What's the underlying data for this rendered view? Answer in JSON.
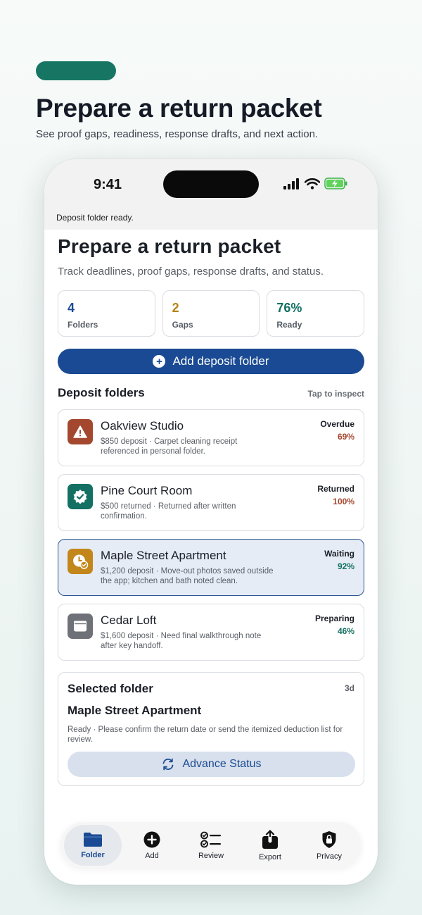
{
  "hero": {
    "title": "Prepare a return packet",
    "subtitle": "See proof gaps, readiness, response drafts, and next action."
  },
  "status_bar": {
    "time": "9:41"
  },
  "toast": "Deposit folder ready.",
  "page": {
    "title": "Prepare a return packet",
    "subtitle": "Track deadlines, proof gaps, response drafts, and status."
  },
  "stats": [
    {
      "value": "4",
      "label": "Folders",
      "color": "#1a4a93"
    },
    {
      "value": "2",
      "label": "Gaps",
      "color": "#b58413"
    },
    {
      "value": "76%",
      "label": "Ready",
      "color": "#137062"
    }
  ],
  "add_button_label": "Add deposit folder",
  "section": {
    "title": "Deposit folders",
    "hint": "Tap to inspect"
  },
  "folders": [
    {
      "name": "Oakview Studio",
      "desc": "$850 deposit · Carpet cleaning receipt referenced in personal folder.",
      "status": "Overdue",
      "pct": "69%",
      "pct_color": "#a3482f",
      "icon": "warning-icon",
      "icon_bg": "#a3482f"
    },
    {
      "name": "Pine Court Room",
      "desc": "$500 returned · Returned after written confirmation.",
      "status": "Returned",
      "pct": "100%",
      "pct_color": "#a3482f",
      "icon": "verified-badge-icon",
      "icon_bg": "#137062"
    },
    {
      "name": "Maple Street Apartment",
      "desc": "$1,200 deposit · Move-out photos saved outside the app; kitchen and bath noted clean.",
      "status": "Waiting",
      "pct": "92%",
      "pct_color": "#137062",
      "icon": "clock-check-icon",
      "icon_bg": "#c3861a"
    },
    {
      "name": "Cedar Loft",
      "desc": "$1,600 deposit · Need final walkthrough note after key handoff.",
      "status": "Preparing",
      "pct": "46%",
      "pct_color": "#137062",
      "icon": "window-icon",
      "icon_bg": "#6e7177"
    }
  ],
  "selected": {
    "heading": "Selected folder",
    "days": "3d",
    "name": "Maple Street Apartment",
    "desc": "Ready · Please confirm the return date or send the itemized deduction list for review.",
    "button_label": "Advance Status"
  },
  "tabs": [
    {
      "label": "Folder",
      "icon": "folder-icon"
    },
    {
      "label": "Add",
      "icon": "add-circle-icon"
    },
    {
      "label": "Review",
      "icon": "checklist-icon"
    },
    {
      "label": "Export",
      "icon": "share-icon"
    },
    {
      "label": "Privacy",
      "icon": "lock-shield-icon"
    }
  ],
  "colors": {
    "accent": "#167563",
    "primary": "#1a4a93"
  }
}
